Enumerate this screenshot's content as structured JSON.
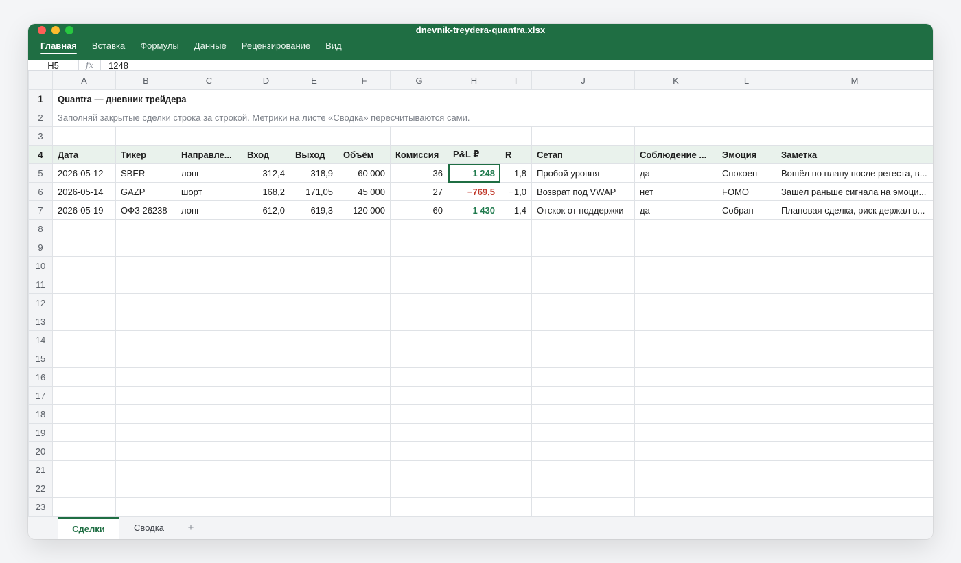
{
  "window": {
    "title": "dnevnik-treydera-quantra.xlsx"
  },
  "ribbon": {
    "tabs": [
      "Главная",
      "Вставка",
      "Формулы",
      "Данные",
      "Рецензирование",
      "Вид"
    ],
    "active_index": 0
  },
  "formula_bar": {
    "cell_ref": "H5",
    "fx_label": "fx",
    "value": "1248"
  },
  "columns": [
    "A",
    "B",
    "C",
    "D",
    "E",
    "F",
    "G",
    "H",
    "I",
    "J",
    "K",
    "L",
    "M"
  ],
  "sheet": {
    "title": "Quantra — дневник трейдера",
    "subtitle": "Заполняй закрытые сделки строка за строкой. Метрики на листе «Сводка» пересчитываются сами.",
    "headers": [
      "Дата",
      "Тикер",
      "Направле...",
      "Вход",
      "Выход",
      "Объём",
      "Комиссия",
      "P&L ₽",
      "R",
      "Сетап",
      "Соблюдение ...",
      "Эмоция",
      "Заметка"
    ],
    "rows": [
      [
        "2026-05-12",
        "SBER",
        "лонг",
        "312,4",
        "318,9",
        "60 000",
        "36",
        "1 248",
        "1,8",
        "Пробой уровня",
        "да",
        "Спокоен",
        "Вошёл по плану после ретеста, в..."
      ],
      [
        "2026-05-14",
        "GAZP",
        "шорт",
        "168,2",
        "171,05",
        "45 000",
        "27",
        "−769,5",
        "−1,0",
        "Возврат под VWAP",
        "нет",
        "FOMO",
        "Зашёл раньше сигнала на эмоци..."
      ],
      [
        "2026-05-19",
        "ОФЗ 26238",
        "лонг",
        "612,0",
        "619,3",
        "120 000",
        "60",
        "1 430",
        "1,4",
        "Отскок от поддержки",
        "да",
        "Собран",
        "Плановая сделка, риск держал в..."
      ]
    ],
    "pnl_sign": [
      "positive",
      "negative",
      "positive"
    ],
    "row_numbers": [
      "1",
      "2",
      "3",
      "4",
      "5",
      "6",
      "7",
      "8",
      "9",
      "10",
      "11",
      "12",
      "13",
      "14",
      "15",
      "16",
      "17",
      "18",
      "19",
      "20",
      "21",
      "22",
      "23"
    ]
  },
  "sheet_tabs": {
    "tabs": [
      "Сделки",
      "Сводка"
    ],
    "active_index": 0,
    "add_label": "+"
  },
  "colors": {
    "accent": "#1f6e43",
    "positive": "#1f7a4d",
    "negative": "#c0392b",
    "header_fill": "#e9f2ec"
  }
}
